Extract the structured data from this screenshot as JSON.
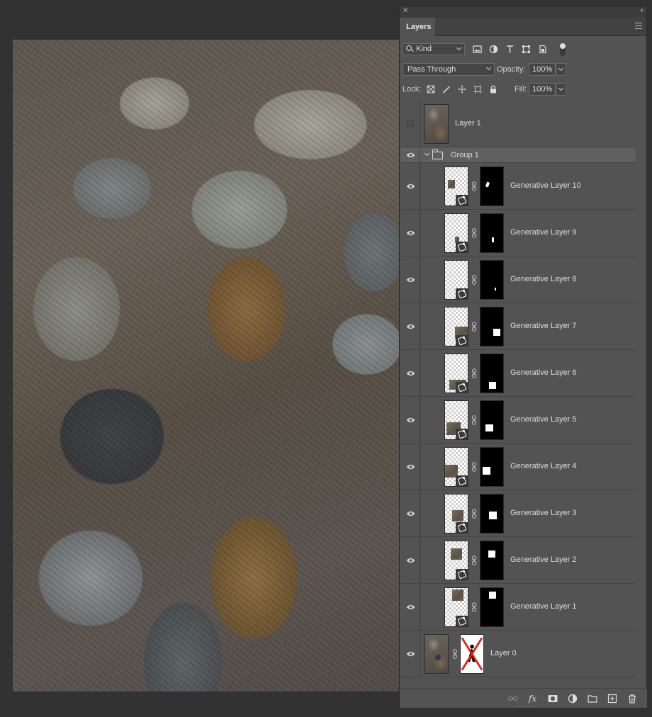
{
  "panel": {
    "tab_label": "Layers",
    "filter": {
      "kind_label": "Kind"
    },
    "blend_mode": "Pass Through",
    "opacity_label": "Opacity:",
    "opacity_value": "100%",
    "lock_label": "Lock:",
    "fill_label": "Fill:",
    "fill_value": "100%"
  },
  "layers": [
    {
      "name": "Layer 1",
      "visible": false,
      "type": "pixel"
    },
    {
      "name": "Group 1",
      "visible": true,
      "type": "group",
      "expanded": true
    },
    {
      "name": "Generative Layer 10",
      "visible": true,
      "type": "generative"
    },
    {
      "name": "Generative Layer 9",
      "visible": true,
      "type": "generative"
    },
    {
      "name": "Generative Layer 8",
      "visible": true,
      "type": "generative"
    },
    {
      "name": "Generative Layer 7",
      "visible": true,
      "type": "generative"
    },
    {
      "name": "Generative Layer 6",
      "visible": true,
      "type": "generative"
    },
    {
      "name": "Generative Layer 5",
      "visible": true,
      "type": "generative"
    },
    {
      "name": "Generative Layer 4",
      "visible": true,
      "type": "generative"
    },
    {
      "name": "Generative Layer 3",
      "visible": true,
      "type": "generative"
    },
    {
      "name": "Generative Layer 2",
      "visible": true,
      "type": "generative"
    },
    {
      "name": "Generative Layer 1",
      "visible": true,
      "type": "generative"
    },
    {
      "name": "Layer 0",
      "visible": true,
      "type": "pixel-with-mask"
    }
  ],
  "footer_icons": [
    "link-layers-icon",
    "fx-icon",
    "add-mask-icon",
    "adjustment-layer-icon",
    "new-group-icon",
    "new-layer-icon",
    "delete-icon"
  ],
  "colors": {
    "panel_bg": "#535353",
    "app_bg": "#323232",
    "mask_x": "#e0201b"
  }
}
